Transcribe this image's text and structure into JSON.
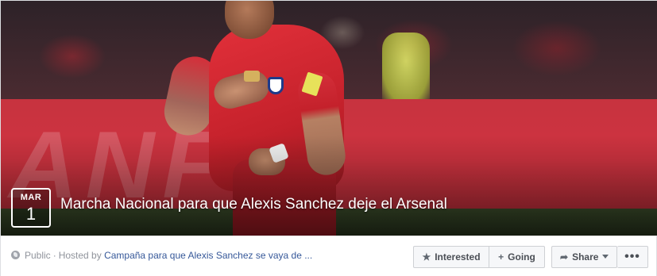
{
  "event": {
    "date_month": "MAR",
    "date_day": "1",
    "title": "Marcha Nacional para que Alexis Sanchez deje el Arsenal"
  },
  "meta": {
    "privacy": "Public",
    "separator": "·",
    "hosted_by_label": "Hosted by",
    "host_name": "Campaña para que Alexis Sanchez se vaya de ..."
  },
  "actions": {
    "interested": {
      "label": "Interested",
      "icon": "star-icon"
    },
    "going": {
      "label": "Going",
      "icon": "plus-icon"
    },
    "share": {
      "label": "Share",
      "icon": "share-arrow-icon"
    },
    "more": {
      "label": "•••",
      "icon": "more-dots-icon"
    }
  },
  "colors": {
    "link": "#365899",
    "meta_text": "#90949c",
    "button_bg": "#f6f7f9",
    "button_border": "#ced0d4"
  }
}
